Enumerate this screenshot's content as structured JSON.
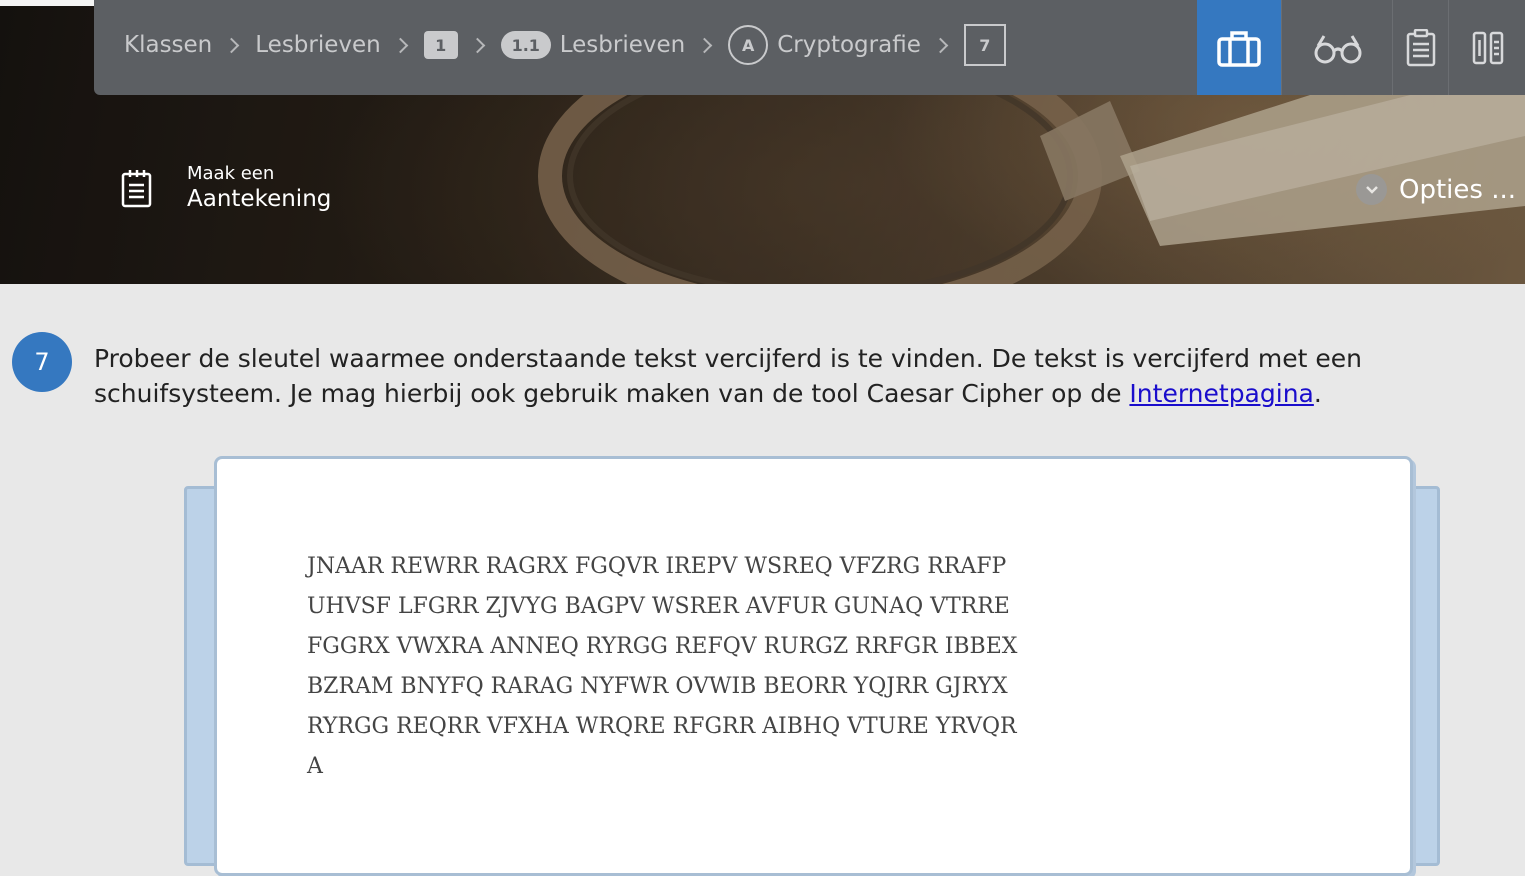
{
  "breadcrumb": {
    "items": [
      {
        "label": "Klassen"
      },
      {
        "label": "Lesbrieven"
      },
      {
        "badge": "1"
      },
      {
        "badge": "1.1",
        "label": "Lesbrieven"
      },
      {
        "badge": "A",
        "label": "Cryptografie"
      },
      {
        "badge": "7"
      }
    ]
  },
  "toolbar": {
    "icons": [
      "briefcase-icon",
      "glasses-icon",
      "clipboard-icon",
      "book-icon"
    ],
    "active": "briefcase-icon"
  },
  "note": {
    "small": "Maak een",
    "big": "Aantekening"
  },
  "options": {
    "label": "Opties ..."
  },
  "question": {
    "number": "7",
    "text_before": "Probeer de sleutel waarmee onderstaande tekst vercijferd is te vinden. De tekst is vercijferd met een schuifsysteem. Je mag hierbij ook gebruik maken van de tool Caesar Cipher op de ",
    "link": "Internetpagina",
    "text_after": "."
  },
  "cipher": {
    "lines": [
      "JNAAR REWRR RAGRX FGQVR IREPV WSREQ VFZRG RRAFP",
      "UHVSF LFGRR ZJVYG BAGPV WSRER AVFUR GUNAQ VTRRE",
      "FGGRX VWXRA ANNEQ RYRGG REFQV RURGZ RRFGR IBBEX",
      "BZRAM BNYFQ RARAG NYFWR OVWIB BEORR YQJRR GJRYX",
      "RYRGG REQRR VFXHA WRQRE RFGRR AIBHQ VTURE YRVQR",
      "A"
    ]
  },
  "colors": {
    "nav_bg": "#5c5f63",
    "accent": "#3578c0",
    "link": "#1a0dcc",
    "card_back": "#bcd2e8"
  }
}
